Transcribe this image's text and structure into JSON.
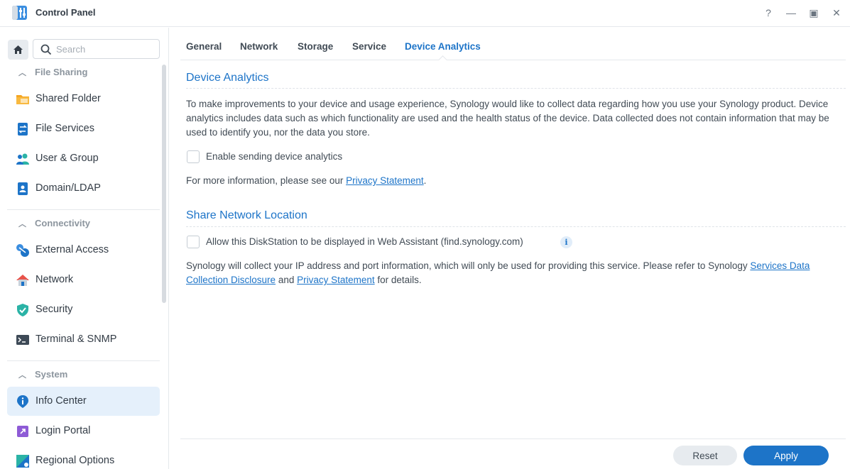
{
  "window": {
    "title": "Control Panel",
    "help_glyph": "?",
    "minimize_glyph": "—",
    "maximize_glyph": "▣",
    "close_glyph": "✕"
  },
  "sidebar": {
    "search_placeholder": "Search",
    "groups": [
      {
        "label": "File Sharing",
        "items": [
          {
            "label": "Shared Folder",
            "icon": "folder-icon"
          },
          {
            "label": "File Services",
            "icon": "file-services-icon"
          },
          {
            "label": "User & Group",
            "icon": "user-group-icon"
          },
          {
            "label": "Domain/LDAP",
            "icon": "domain-ldap-icon"
          }
        ]
      },
      {
        "label": "Connectivity",
        "items": [
          {
            "label": "External Access",
            "icon": "external-access-icon"
          },
          {
            "label": "Network",
            "icon": "network-house-icon"
          },
          {
            "label": "Security",
            "icon": "shield-icon"
          },
          {
            "label": "Terminal & SNMP",
            "icon": "terminal-icon"
          }
        ]
      },
      {
        "label": "System",
        "items": [
          {
            "label": "Info Center",
            "icon": "info-center-icon",
            "active": true
          },
          {
            "label": "Login Portal",
            "icon": "login-portal-icon"
          },
          {
            "label": "Regional Options",
            "icon": "regional-options-icon"
          }
        ]
      }
    ]
  },
  "tabs": [
    {
      "label": "General"
    },
    {
      "label": "Network"
    },
    {
      "label": "Storage"
    },
    {
      "label": "Service"
    },
    {
      "label": "Device Analytics",
      "active": true
    }
  ],
  "device_analytics": {
    "title": "Device Analytics",
    "description": "To make improvements to your device and usage experience, Synology would like to collect data regarding how you use your Synology product. Device analytics includes data such as which functionality are used and the health status of the device. Data collected does not contain information that may be used to identify you, nor the data you store.",
    "checkbox_label": "Enable sending device analytics",
    "checked": false,
    "more_info_prefix": "For more information, please see our ",
    "privacy_link": "Privacy Statement",
    "more_info_suffix": "."
  },
  "share_network_location": {
    "title": "Share Network Location",
    "checkbox_label": "Allow this DiskStation to be displayed in Web Assistant (find.synology.com)",
    "checked": false,
    "info_glyph": "i",
    "note_prefix": "Synology will collect your IP address and port information, which will only be used for providing this service. Please refer to Synology ",
    "disclosure_link": "Services Data Collection Disclosure",
    "note_and": " and ",
    "privacy_link": "Privacy Statement",
    "note_suffix": " for details."
  },
  "footer": {
    "reset_label": "Reset",
    "apply_label": "Apply"
  },
  "colors": {
    "accent": "#1d74c8",
    "active_item_bg": "#e5f0fb"
  }
}
